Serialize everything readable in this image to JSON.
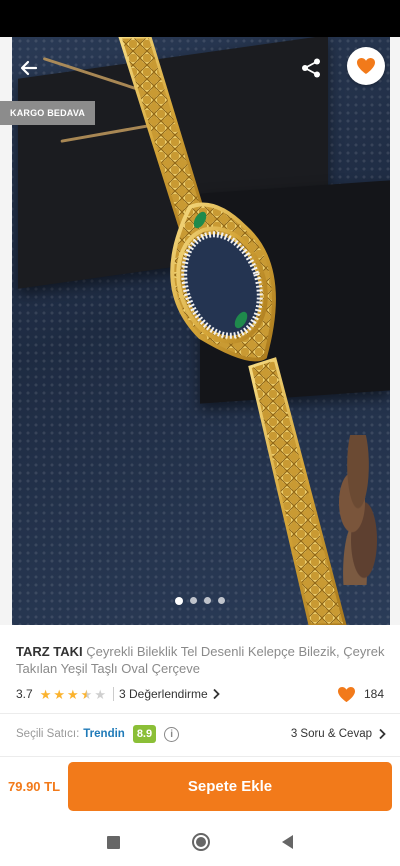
{
  "badge": {
    "shipping": "KARGO BEDAVA"
  },
  "gallery": {
    "image_count": 4,
    "active_index": 0
  },
  "product": {
    "brand": "TARZ TAKI",
    "name": "Çeyrekli Bileklik Tel Desenli Kelepçe Bilezik, Çeyrek Takılan Yeşil Taşlı Oval Çerçeve"
  },
  "rating": {
    "score": "3.7",
    "score_value": 3.7,
    "max_stars": 5,
    "reviews_label": "3 Değerlendirme",
    "likes": "184"
  },
  "seller": {
    "label": "Seçili Satıcı:",
    "name": "Trendin",
    "score": "8.9",
    "qa_label": "3 Soru & Cevap"
  },
  "purchase": {
    "price": "79.90 TL",
    "button_label": "Sepete Ekle"
  },
  "colors": {
    "accent": "#f27a1a",
    "seller_link": "#1f7ab8",
    "score_badge": "#8bbf37",
    "star": "#fbb32e"
  },
  "icons": {
    "back": "arrow-left-icon",
    "share": "share-icon",
    "favorite": "heart-icon",
    "info": "info-icon",
    "chevron": "chevron-right-icon"
  }
}
